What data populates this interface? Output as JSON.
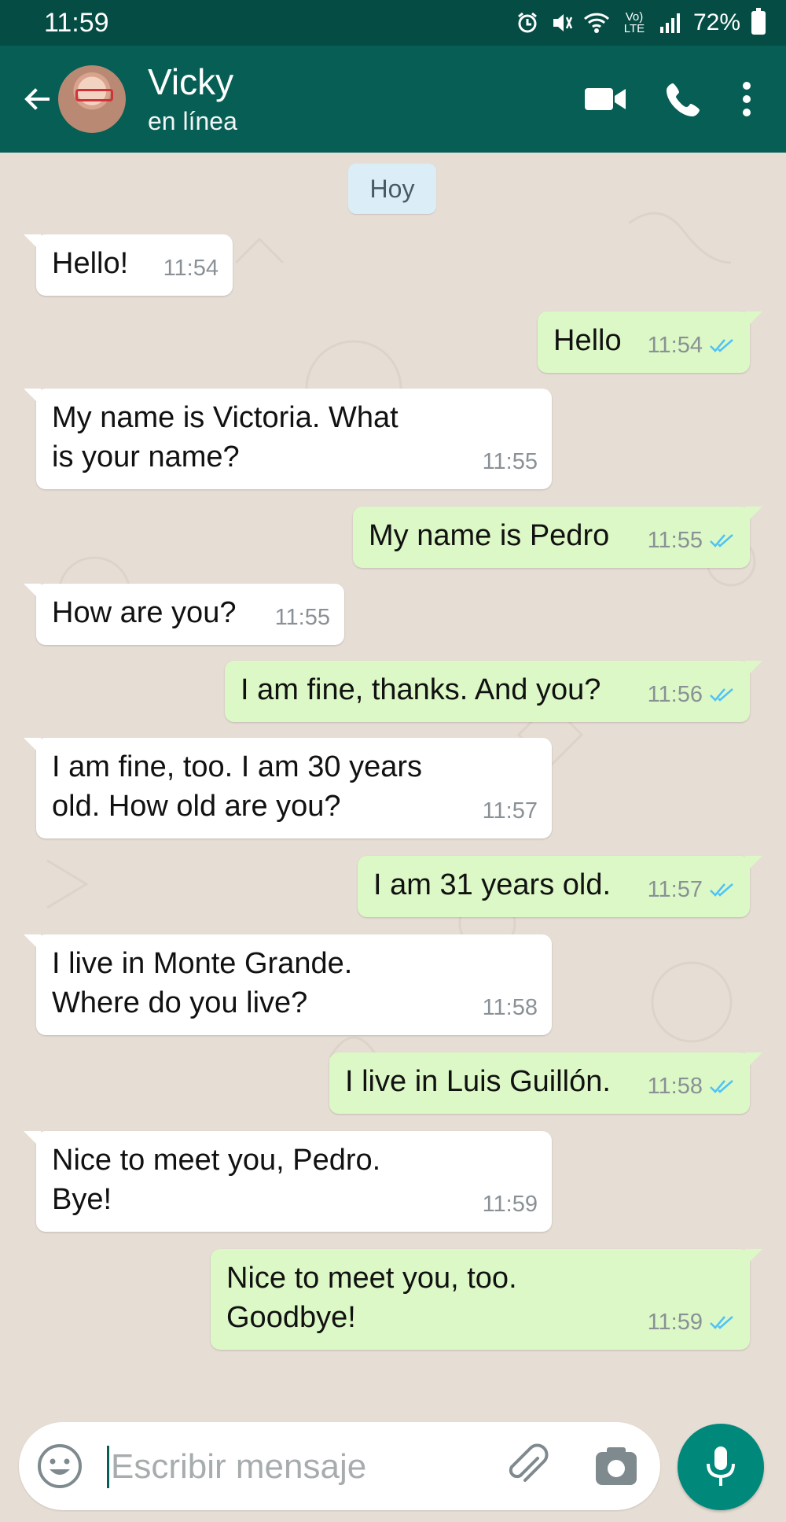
{
  "status_bar": {
    "time": "11:59",
    "network": "Vo) LTE",
    "battery": "72%"
  },
  "header": {
    "contact_name": "Vicky",
    "contact_status": "en línea"
  },
  "chat": {
    "date_label": "Hoy",
    "messages": [
      {
        "direction": "in",
        "lines": [
          "Hello!"
        ],
        "time": "11:54"
      },
      {
        "direction": "out",
        "lines": [
          "Hello"
        ],
        "time": "11:54"
      },
      {
        "direction": "in",
        "lines": [
          "My name is Victoria. What",
          "is your name?"
        ],
        "time": "11:55"
      },
      {
        "direction": "out",
        "lines": [
          "My name is Pedro"
        ],
        "time": "11:55"
      },
      {
        "direction": "in",
        "lines": [
          "How are you?"
        ],
        "time": "11:55"
      },
      {
        "direction": "out",
        "lines": [
          "I am fine, thanks. And you?"
        ],
        "time": "11:56"
      },
      {
        "direction": "in",
        "lines": [
          "I am fine, too. I am 30 years",
          "old. How old are you?"
        ],
        "time": "11:57"
      },
      {
        "direction": "out",
        "lines": [
          "I am 31 years old."
        ],
        "time": "11:57"
      },
      {
        "direction": "in",
        "lines": [
          "I live in Monte Grande.",
          "Where do you live?"
        ],
        "time": "11:58"
      },
      {
        "direction": "out",
        "lines": [
          "I live in Luis Guillón."
        ],
        "time": "11:58"
      },
      {
        "direction": "in",
        "lines": [
          "Nice to meet you, Pedro.",
          "Bye!"
        ],
        "time": "11:59"
      },
      {
        "direction": "out",
        "lines": [
          "Nice to meet you, too.",
          "Goodbye!"
        ],
        "time": "11:59"
      }
    ]
  },
  "composer": {
    "placeholder": "Escribir mensaje"
  },
  "colors": {
    "header": "#075e54",
    "status_bar": "#054d44",
    "outgoing_bubble": "#dcf8c6",
    "incoming_bubble": "#ffffff",
    "read_ticks": "#4fc3f7",
    "mic_button": "#00897b"
  },
  "icons": {
    "back": "arrow-left-icon",
    "video": "video-camera-icon",
    "call": "phone-icon",
    "menu": "more-vertical-icon",
    "emoji": "emoji-icon",
    "attach": "paperclip-icon",
    "camera": "camera-icon",
    "mic": "microphone-icon"
  }
}
